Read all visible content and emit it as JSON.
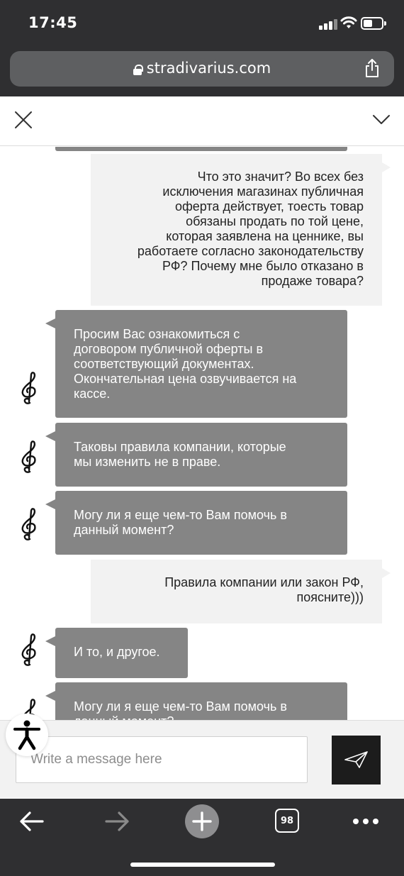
{
  "status_bar": {
    "time": "17:45"
  },
  "browser": {
    "url": "stradivarius.com",
    "tab_count": "98"
  },
  "chat": {
    "messages": [
      {
        "sender": "user",
        "text": "Что это значит? Во всех без\nисключения магазинах публичная\nоферта действует, тоесть товар\nобязаны продать по той цене,\nкоторая заявлена на ценнике, вы\nработаете согласно законодательству\nРФ? Почему мне было отказано в\nпродаже товара?"
      },
      {
        "sender": "agent",
        "text": "Просим Вас ознакомиться с\nдоговором публичной оферты в\nсоответствующий документах.\nОкончательная цена озвучивается на\nкассе."
      },
      {
        "sender": "agent",
        "text": "Таковы правила компании, которые\nмы изменить не в праве."
      },
      {
        "sender": "agent",
        "text": "Могу ли я еще чем-то Вам помочь в\nданный момент?"
      },
      {
        "sender": "user",
        "text": "Правила компании или закон РФ,\nпоясните)))"
      },
      {
        "sender": "agent",
        "text": "И то, и другое."
      },
      {
        "sender": "agent",
        "text": "Могу ли я еще чем-то Вам помочь в\nданный момент?"
      }
    ],
    "input_placeholder": "Write a message here"
  },
  "colors": {
    "user_bubble": "#f2f2f2",
    "agent_bubble": "#858585",
    "chrome": "#2f2f31",
    "send_button": "#1c1c1c"
  }
}
